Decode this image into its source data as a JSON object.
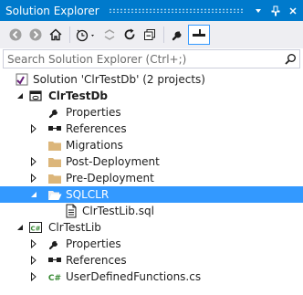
{
  "window": {
    "title": "Solution Explorer"
  },
  "search": {
    "placeholder": "Search Solution Explorer (Ctrl+;)"
  },
  "tree": {
    "solution": "Solution 'ClrTestDb' (2 projects)",
    "project1": "ClrTestDb",
    "p1_properties": "Properties",
    "p1_references": "References",
    "migrations": "Migrations",
    "post_deployment": "Post-Deployment",
    "pre_deployment": "Pre-Deployment",
    "sqlclr": "SQLCLR",
    "sql_file": "ClrTestLib.sql",
    "project2": "ClrTestLib",
    "p2_properties": "Properties",
    "p2_references": "References",
    "cs_file": "UserDefinedFunctions.cs"
  },
  "colors": {
    "accent": "#007acc",
    "selection": "#3399ff",
    "folder": "#dcb67a"
  }
}
